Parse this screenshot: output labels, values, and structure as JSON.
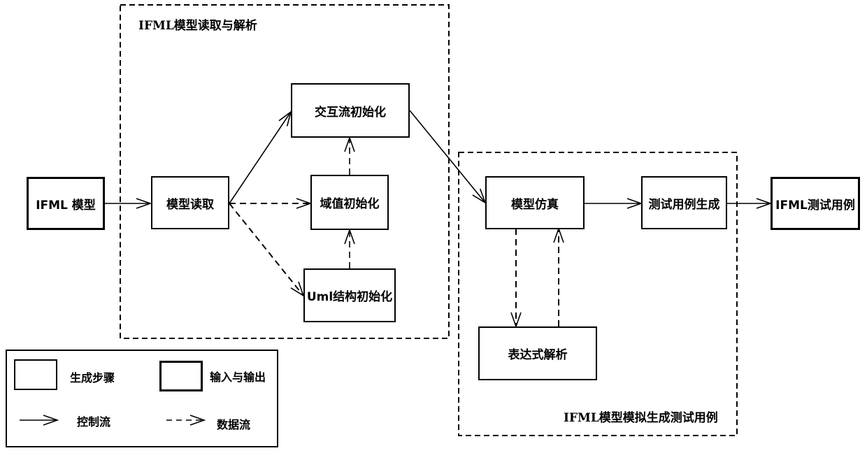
{
  "groups": {
    "parse": {
      "label": "IFML模型读取与解析"
    },
    "simulate": {
      "label": "IFML模型模拟生成测试用例"
    }
  },
  "nodes": {
    "ifml_model": {
      "label": "IFML 模型",
      "kind": "input-output"
    },
    "model_read": {
      "label": "模型读取",
      "kind": "step"
    },
    "interaction_init": {
      "label": "交互流初始化",
      "kind": "step"
    },
    "domain_init": {
      "label": "域值初始化",
      "kind": "step"
    },
    "uml_init": {
      "label": "Uml结构初始化",
      "kind": "step"
    },
    "model_sim": {
      "label": "模型仿真",
      "kind": "step"
    },
    "testcase_gen": {
      "label": "测试用例生成",
      "kind": "step"
    },
    "expr_parse": {
      "label": "表达式解析",
      "kind": "step"
    },
    "ifml_testcase": {
      "label": "IFML测试用例",
      "kind": "input-output"
    }
  },
  "edges": [
    {
      "from": "ifml_model",
      "to": "model_read",
      "type": "control"
    },
    {
      "from": "model_read",
      "to": "interaction_init",
      "type": "control"
    },
    {
      "from": "model_read",
      "to": "domain_init",
      "type": "data"
    },
    {
      "from": "model_read",
      "to": "uml_init",
      "type": "data"
    },
    {
      "from": "domain_init",
      "to": "interaction_init",
      "type": "data"
    },
    {
      "from": "uml_init",
      "to": "domain_init",
      "type": "data"
    },
    {
      "from": "interaction_init",
      "to": "model_sim",
      "type": "control"
    },
    {
      "from": "model_sim",
      "to": "testcase_gen",
      "type": "control"
    },
    {
      "from": "testcase_gen",
      "to": "ifml_testcase",
      "type": "control"
    },
    {
      "from": "model_sim",
      "to": "expr_parse",
      "type": "data"
    },
    {
      "from": "expr_parse",
      "to": "model_sim",
      "type": "data"
    }
  ],
  "legend": {
    "step": "生成步骤",
    "io": "输入与输出",
    "control": "控制流",
    "data": "数据流"
  }
}
